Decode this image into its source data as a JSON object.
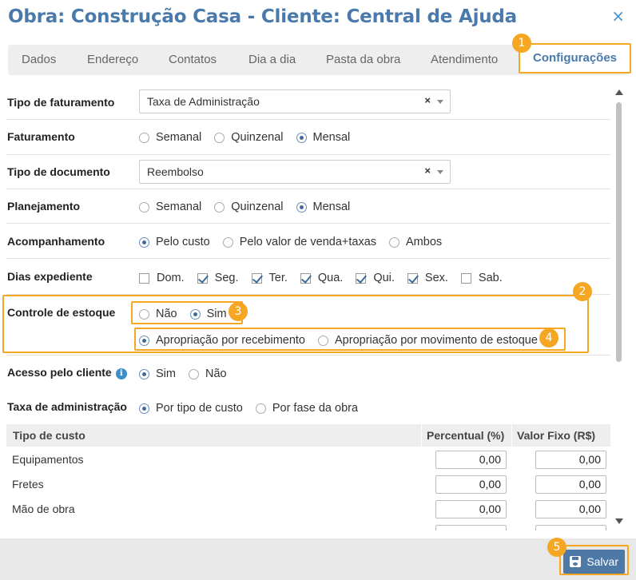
{
  "dialog": {
    "title": "Obra: Construção Casa - Cliente: Central de Ajuda",
    "close_icon": "×"
  },
  "tabs": [
    {
      "label": "Dados"
    },
    {
      "label": "Endereço"
    },
    {
      "label": "Contatos"
    },
    {
      "label": "Dia a dia"
    },
    {
      "label": "Pasta da obra"
    },
    {
      "label": "Atendimento"
    },
    {
      "label": "Configurações",
      "active": true
    }
  ],
  "form": {
    "tipo_faturamento": {
      "label": "Tipo de faturamento",
      "value": "Taxa de Administração",
      "clear": "×"
    },
    "faturamento": {
      "label": "Faturamento",
      "options": [
        "Semanal",
        "Quinzenal",
        "Mensal"
      ],
      "selected": "Mensal"
    },
    "tipo_documento": {
      "label": "Tipo de documento",
      "value": "Reembolso",
      "clear": "×"
    },
    "planejamento": {
      "label": "Planejamento",
      "options": [
        "Semanal",
        "Quinzenal",
        "Mensal"
      ],
      "selected": "Mensal"
    },
    "acompanhamento": {
      "label": "Acompanhamento",
      "options": [
        "Pelo custo",
        "Pelo valor de venda+taxas",
        "Ambos"
      ],
      "selected": "Pelo custo"
    },
    "dias_expediente": {
      "label": "Dias expediente",
      "days": [
        {
          "label": "Dom.",
          "checked": false
        },
        {
          "label": "Seg.",
          "checked": true
        },
        {
          "label": "Ter.",
          "checked": true
        },
        {
          "label": "Qua.",
          "checked": true
        },
        {
          "label": "Qui.",
          "checked": true
        },
        {
          "label": "Sex.",
          "checked": true
        },
        {
          "label": "Sab.",
          "checked": false
        }
      ]
    },
    "controle_estoque": {
      "label": "Controle de estoque",
      "options": [
        "Não",
        "Sim"
      ],
      "selected": "Sim",
      "sub_options": [
        "Apropriação por recebimento",
        "Apropriação por movimento de estoque"
      ],
      "sub_selected": "Apropriação por recebimento"
    },
    "acesso_cliente": {
      "label": "Acesso pelo cliente",
      "info_icon": "i",
      "options": [
        "Sim",
        "Não"
      ],
      "selected": "Sim"
    },
    "taxa_administracao": {
      "label": "Taxa de administração",
      "options": [
        "Por tipo de custo",
        "Por fase da obra"
      ],
      "selected": "Por tipo de custo"
    }
  },
  "table": {
    "headers": [
      "Tipo de custo",
      "Percentual (%)",
      "Valor Fixo (R$)"
    ],
    "rows": [
      {
        "name": "Equipamentos",
        "percentual": "0,00",
        "valor": "0,00"
      },
      {
        "name": "Fretes",
        "percentual": "0,00",
        "valor": "0,00"
      },
      {
        "name": "Mão de obra",
        "percentual": "0,00",
        "valor": "0,00"
      }
    ]
  },
  "callouts": [
    "1",
    "2",
    "3",
    "4",
    "5"
  ],
  "footer": {
    "save_label": "Salvar"
  },
  "colors": {
    "accent": "#f5a623",
    "title": "#4a7aab",
    "button": "#4e79a7"
  }
}
